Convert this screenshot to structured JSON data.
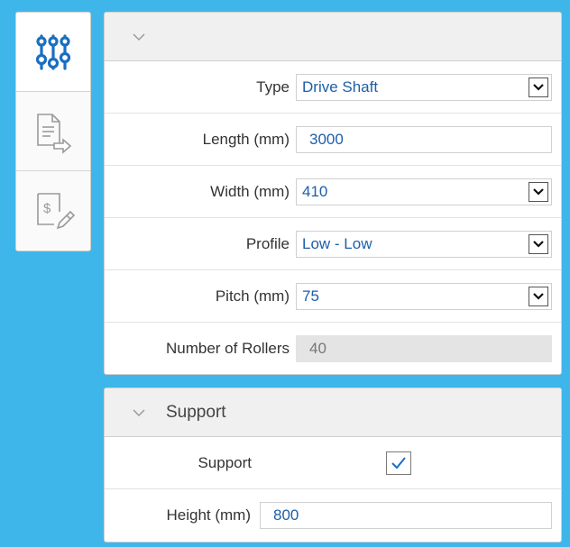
{
  "rail": {
    "items": [
      {
        "icon": "sliders-icon",
        "active": true
      },
      {
        "icon": "document-export-icon",
        "active": false
      },
      {
        "icon": "invoice-edit-icon",
        "active": false
      }
    ]
  },
  "general_panel": {
    "title": "",
    "fields": {
      "type": {
        "label": "Type",
        "value": "Drive Shaft"
      },
      "length": {
        "label": "Length (mm)",
        "value": "3000"
      },
      "width": {
        "label": "Width (mm)",
        "value": "410"
      },
      "profile": {
        "label": "Profile",
        "value": "Low - Low"
      },
      "pitch": {
        "label": "Pitch (mm)",
        "value": "75"
      },
      "rollers": {
        "label": "Number of Rollers",
        "value": "40"
      }
    }
  },
  "support_panel": {
    "title": "Support",
    "fields": {
      "support": {
        "label": "Support",
        "checked": true
      },
      "height": {
        "label": "Height (mm)",
        "value": "800"
      }
    }
  },
  "colors": {
    "background": "#3fb6ea",
    "accent": "#1e5fa8",
    "icon": "#1a6fc0"
  }
}
